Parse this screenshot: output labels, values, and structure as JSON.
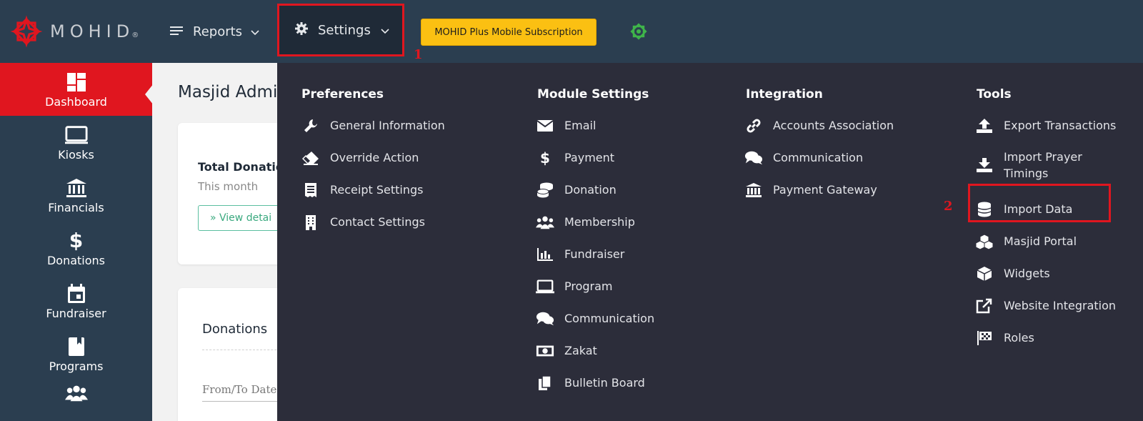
{
  "brand": {
    "name": "MOHID",
    "reg": "®",
    "logo_color": "#e0161f"
  },
  "topnav": {
    "reports_label": "Reports",
    "settings_label": "Settings",
    "subscription_label": "MOHID Plus Mobile Subscription"
  },
  "annotations": {
    "step1": "1",
    "step2": "2"
  },
  "sidebar": {
    "items": [
      {
        "label": "Dashboard",
        "icon": "dashboard-icon"
      },
      {
        "label": "Kiosks",
        "icon": "monitor-icon"
      },
      {
        "label": "Financials",
        "icon": "bank-icon"
      },
      {
        "label": "Donations",
        "icon": "dollar-icon"
      },
      {
        "label": "Fundraiser",
        "icon": "calendar-icon"
      },
      {
        "label": "Programs",
        "icon": "book-icon"
      }
    ]
  },
  "main": {
    "page_title": "Masjid Admi",
    "card_total": {
      "title": "Total Donatio",
      "subtitle": "This month",
      "button": "» View detai"
    },
    "card_donations": {
      "title": "Donations",
      "date_label": "From/To Date"
    }
  },
  "dropdown": {
    "preferences": {
      "title": "Preferences",
      "items": [
        "General Information",
        "Override Action",
        "Receipt Settings",
        "Contact Settings"
      ]
    },
    "module_settings": {
      "title": "Module Settings",
      "items": [
        "Email",
        "Payment",
        "Donation",
        "Membership",
        "Fundraiser",
        "Program",
        "Communication",
        "Zakat",
        "Bulletin Board"
      ]
    },
    "integration": {
      "title": "Integration",
      "items": [
        "Accounts Association",
        "Communication",
        "Payment Gateway"
      ]
    },
    "tools": {
      "title": "Tools",
      "items": [
        "Export Transactions",
        "Import Prayer Timings",
        "Import Data",
        "Masjid Portal",
        "Widgets",
        "Website Integration",
        "Roles"
      ]
    }
  }
}
